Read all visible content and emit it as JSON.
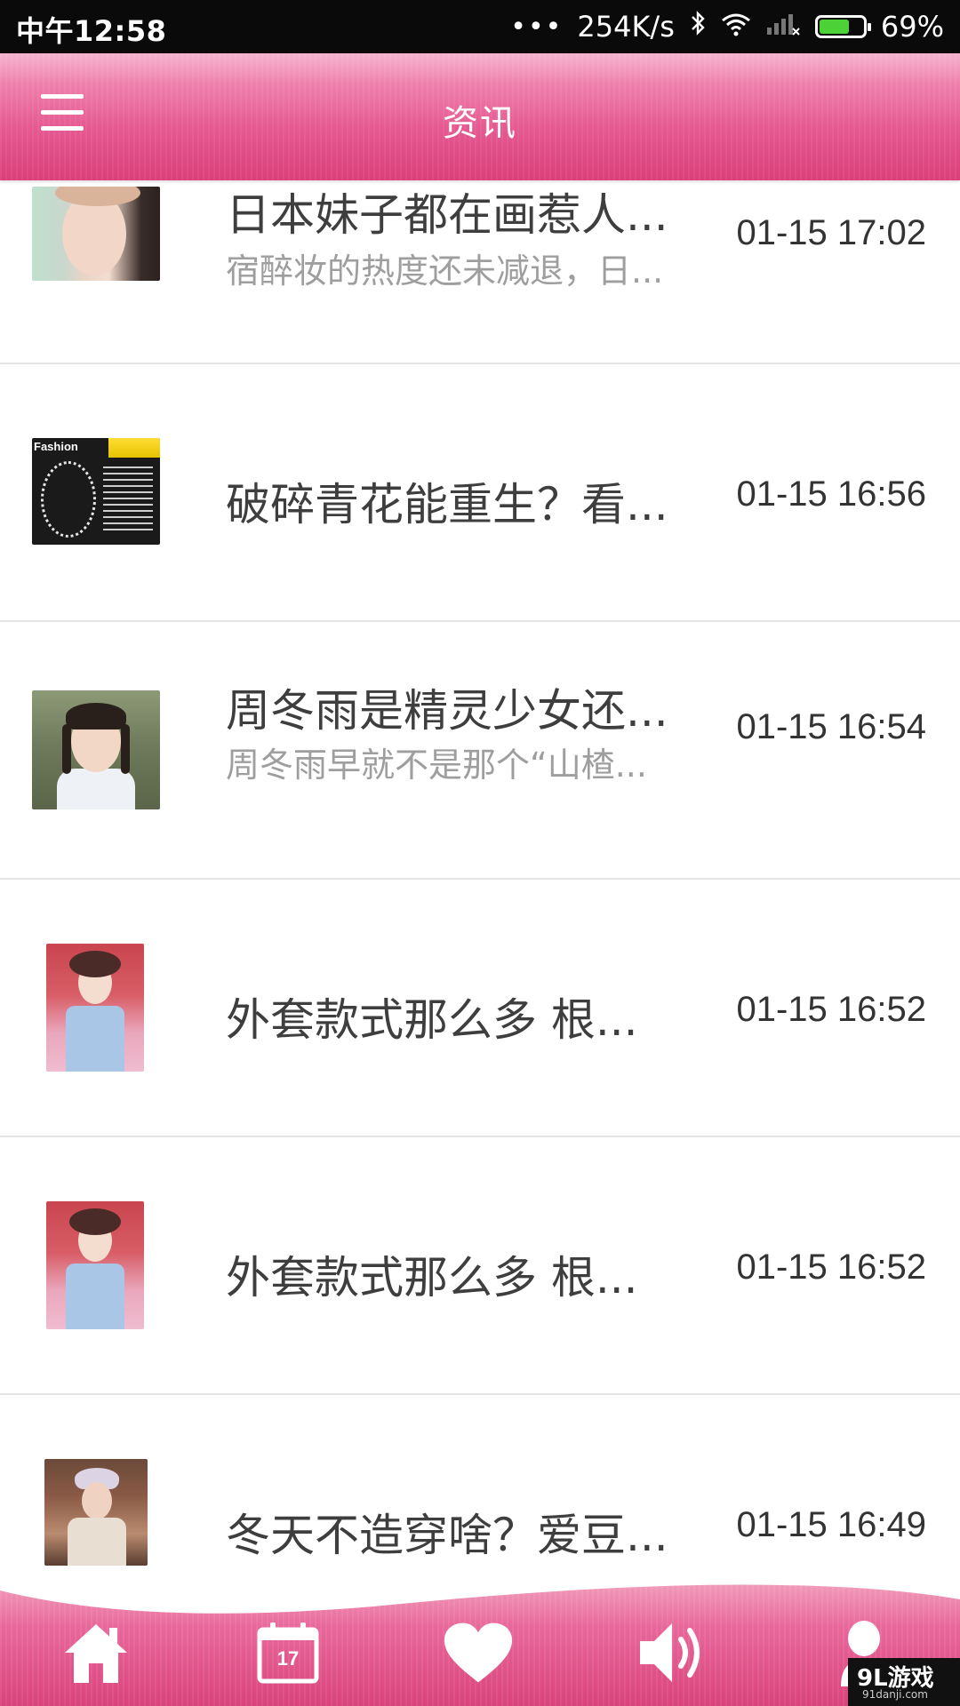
{
  "status_bar": {
    "time": "中午12:58",
    "dots": "•••",
    "network_speed": "254K/s",
    "battery_percent": "69%",
    "battery_level": 0.69
  },
  "header": {
    "title": "资讯",
    "menu_icon": "hamburger-menu-icon"
  },
  "news": [
    {
      "title": "日本妹子都在画惹人...",
      "summary": "宿醉妆的热度还未减退，日...",
      "time": "01-15 17:02"
    },
    {
      "title": "破碎青花能重生？看...",
      "summary": "",
      "time": "01-15 16:56",
      "thumb_text": "Fashion"
    },
    {
      "title": "周冬雨是精灵少女还...",
      "summary": "周冬雨早就不是那个“山楂...",
      "time": "01-15 16:54"
    },
    {
      "title": "外套款式那么多 根...",
      "summary": "",
      "time": "01-15 16:52"
    },
    {
      "title": "外套款式那么多 根...",
      "summary": "",
      "time": "01-15 16:52"
    },
    {
      "title": "冬天不造穿啥？爱豆...",
      "summary": "",
      "time": "01-15 16:49"
    }
  ],
  "bottom_nav": {
    "items": [
      {
        "icon": "home-icon"
      },
      {
        "icon": "calendar-icon",
        "label": "17"
      },
      {
        "icon": "heart-icon"
      },
      {
        "icon": "speaker-icon"
      },
      {
        "icon": "profile-icon"
      }
    ]
  },
  "colors": {
    "accent": "#e55890",
    "header_dark": "#db3f79",
    "header_light": "#f6b4cf"
  },
  "watermark": {
    "brand": "9L游戏",
    "url": "91danji.com"
  }
}
